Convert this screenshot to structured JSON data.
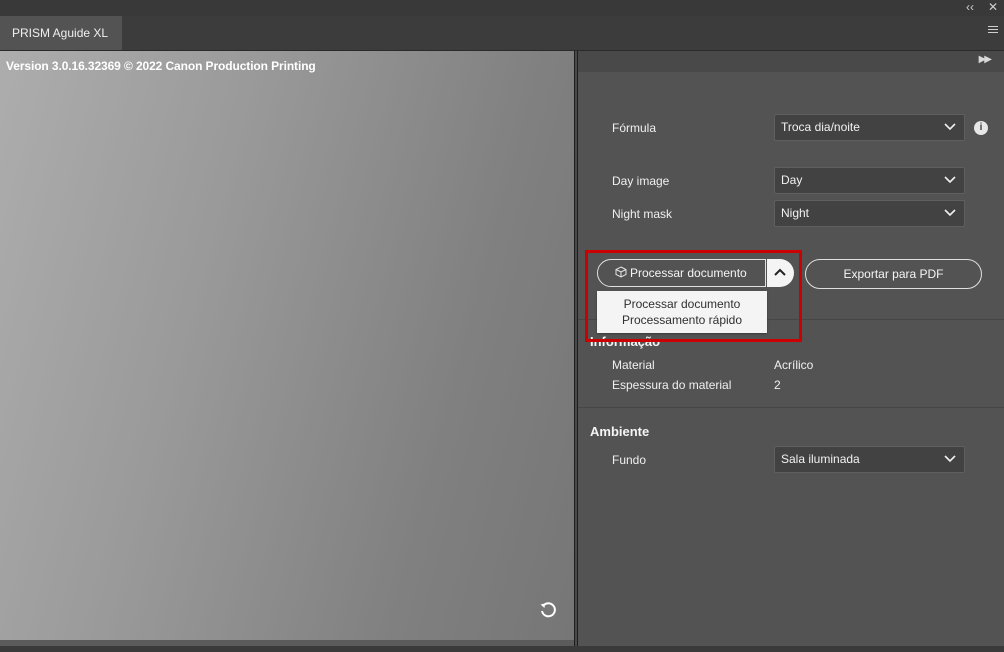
{
  "window": {
    "collapse_icon": "double-chevron-left",
    "close_icon": "close"
  },
  "tab": {
    "label": "PRISM Aguide XL"
  },
  "preview": {
    "version_text": "Version 3.0.16.32369 © 2022 Canon Production Printing"
  },
  "panel": {
    "formula": {
      "label": "Fórmula",
      "value": "Troca dia/noite",
      "info_icon": "info"
    },
    "day_image": {
      "label": "Day image",
      "value": "Day"
    },
    "night_mask": {
      "label": "Night mask",
      "value": "Night"
    },
    "process_button": {
      "label": "Processar documento",
      "icon": "cube"
    },
    "export_button": {
      "label": "Exportar para PDF"
    },
    "process_menu": {
      "items": [
        "Processar documento",
        "Processamento rápido"
      ]
    },
    "info_section": {
      "title": "Informação",
      "rows": [
        {
          "label": "Material",
          "value": "Acrílico"
        },
        {
          "label": "Espessura do material",
          "value": "2"
        }
      ]
    },
    "ambient_section": {
      "title": "Ambiente",
      "background": {
        "label": "Fundo",
        "value": "Sala iluminada"
      }
    }
  },
  "colors": {
    "panel_bg": "#535353",
    "highlight": "#cc0000"
  }
}
